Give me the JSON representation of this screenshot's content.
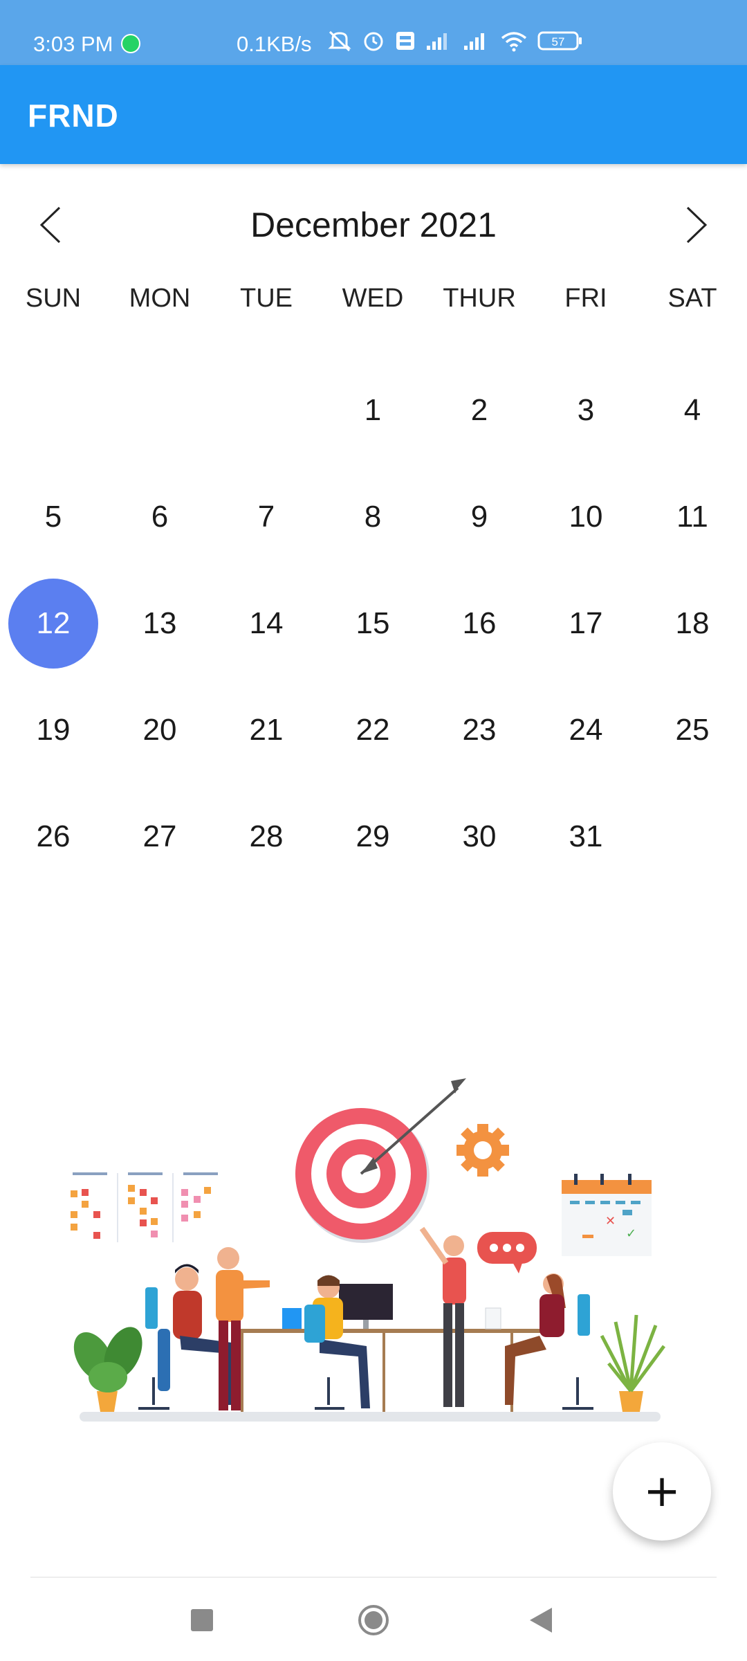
{
  "status_bar": {
    "time": "3:03 PM",
    "net_speed": "0.1KB/s",
    "battery": "57",
    "icons": [
      "whatsapp-icon",
      "mute-icon",
      "alarm-icon",
      "volte-icon",
      "signal-icon",
      "wifi-icon",
      "battery-icon"
    ]
  },
  "app_bar": {
    "title": "FRND",
    "color": "#2196f3"
  },
  "calendar": {
    "month_label": "December 2021",
    "weekdays": [
      "SUN",
      "MON",
      "TUE",
      "WED",
      "THUR",
      "FRI",
      "SAT"
    ],
    "selected_day": "12",
    "selected_color": "#5b7ff0",
    "weeks": [
      [
        "",
        "",
        "",
        "1",
        "2",
        "3",
        "4"
      ],
      [
        "5",
        "6",
        "7",
        "8",
        "9",
        "10",
        "11"
      ],
      [
        "12",
        "13",
        "14",
        "15",
        "16",
        "17",
        "18"
      ],
      [
        "19",
        "20",
        "21",
        "22",
        "23",
        "24",
        "25"
      ],
      [
        "26",
        "27",
        "28",
        "29",
        "30",
        "31",
        ""
      ]
    ]
  },
  "fab": {
    "label": "+"
  },
  "system_nav": [
    "recents-icon",
    "home-icon",
    "back-icon"
  ]
}
